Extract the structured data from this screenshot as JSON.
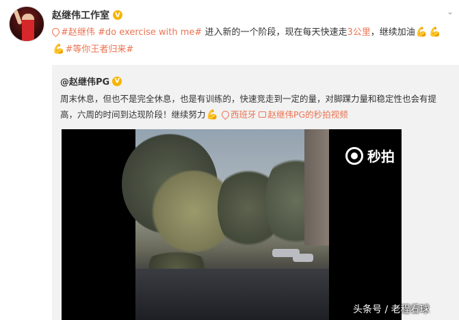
{
  "post": {
    "author": "赵继伟工作室",
    "verified_badge": "V",
    "text_parts": {
      "tag1": "#赵继伟 #do exercise with me#",
      "body": " 进入新的一个阶段，现在每天快速走",
      "distance": "3公里",
      "after": "，继续加油",
      "tag2": "#等你王者归来#"
    }
  },
  "repost": {
    "author": "@赵继伟PG",
    "verified_badge": "V",
    "text": "周末休息，但也不是完全休息，也是有训练的，快速竞走到一定的量，对脚踝力量和稳定性也会有提高，六周的时间到达现阶段！继续努力",
    "location": "西班牙",
    "video_link": "赵继伟PG的秒拍视频"
  },
  "video": {
    "brand": "秒拍"
  },
  "watermark": "头条号 / 老程看球",
  "colors": {
    "link": "#eb7350",
    "repost_bg": "#f2f2f2",
    "badge": "#f7b500"
  },
  "icons": [
    "avatar",
    "verified-badge",
    "location-icon",
    "flexed-arm-icon",
    "video-link-icon",
    "miaopai-eye-icon",
    "chevron-down-icon"
  ]
}
